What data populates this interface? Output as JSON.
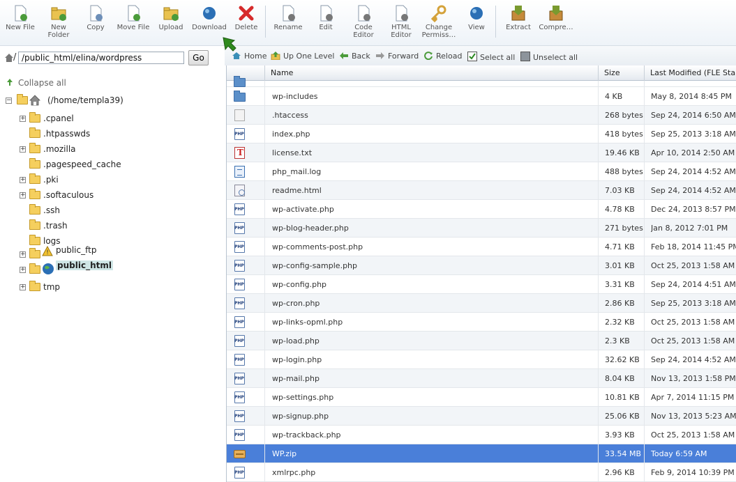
{
  "toolbar": {
    "buttons": [
      {
        "label": "New File",
        "icon": "new-file-icon"
      },
      {
        "label": "New\nFolder",
        "icon": "new-folder-icon"
      },
      {
        "label": "Copy",
        "icon": "copy-icon"
      },
      {
        "label": "Move File",
        "icon": "move-file-icon"
      },
      {
        "label": "Upload",
        "icon": "upload-icon"
      },
      {
        "label": "Download",
        "icon": "download-icon"
      },
      {
        "label": "Delete",
        "icon": "delete-icon"
      },
      {
        "label": "Rename",
        "icon": "rename-icon"
      },
      {
        "label": "Edit",
        "icon": "edit-icon"
      },
      {
        "label": "Code\nEditor",
        "icon": "code-editor-icon"
      },
      {
        "label": "HTML\nEditor",
        "icon": "html-editor-icon"
      },
      {
        "label": "Change\nPermiss…",
        "icon": "change-permissions-icon"
      },
      {
        "label": "View",
        "icon": "view-icon"
      },
      {
        "label": "Extract",
        "icon": "extract-icon"
      },
      {
        "label": "Compre…",
        "icon": "compress-icon"
      }
    ]
  },
  "pathbar": {
    "value": "/public_html/elina/wordpress",
    "go_label": "Go"
  },
  "tree": {
    "collapse_label": "Collapse all",
    "root": "(/home/templa39)",
    "items": [
      {
        "name": ".cpanel",
        "expandable": true
      },
      {
        "name": ".htpasswds",
        "expandable": false
      },
      {
        "name": ".mozilla",
        "expandable": true
      },
      {
        "name": ".pagespeed_cache",
        "expandable": false
      },
      {
        "name": ".pki",
        "expandable": true
      },
      {
        "name": ".softaculous",
        "expandable": true
      },
      {
        "name": ".ssh",
        "expandable": false
      },
      {
        "name": ".trash",
        "expandable": false
      },
      {
        "name": "logs",
        "expandable": false
      },
      {
        "name": "public_ftp",
        "expandable": true
      },
      {
        "name": "public_html",
        "expandable": true
      },
      {
        "name": "tmp",
        "expandable": true
      }
    ]
  },
  "nav": {
    "home": "Home",
    "up": "Up One Level",
    "back": "Back",
    "forward": "Forward",
    "reload": "Reload",
    "select_all": "Select all",
    "unselect_all": "Unselect all"
  },
  "table": {
    "headers": {
      "name": "Name",
      "size": "Size",
      "modified": "Last Modified (FLE Stand"
    },
    "rows": [
      {
        "name": "wp-includes",
        "size": "4 KB",
        "modified": "May 8, 2014 8:45 PM",
        "type": "folder"
      },
      {
        "name": ".htaccess",
        "size": "268 bytes",
        "modified": "Sep 24, 2014 6:50 AM",
        "type": "generic"
      },
      {
        "name": "index.php",
        "size": "418 bytes",
        "modified": "Sep 25, 2013 3:18 AM",
        "type": "php"
      },
      {
        "name": "license.txt",
        "size": "19.46 KB",
        "modified": "Apr 10, 2014 2:50 AM",
        "type": "text"
      },
      {
        "name": "php_mail.log",
        "size": "488 bytes",
        "modified": "Sep 24, 2014 4:52 AM",
        "type": "log"
      },
      {
        "name": "readme.html",
        "size": "7.03 KB",
        "modified": "Sep 24, 2014 4:52 AM",
        "type": "html"
      },
      {
        "name": "wp-activate.php",
        "size": "4.78 KB",
        "modified": "Dec 24, 2013 8:57 PM",
        "type": "php"
      },
      {
        "name": "wp-blog-header.php",
        "size": "271 bytes",
        "modified": "Jan 8, 2012 7:01 PM",
        "type": "php"
      },
      {
        "name": "wp-comments-post.php",
        "size": "4.71 KB",
        "modified": "Feb 18, 2014 11:45 PM",
        "type": "php"
      },
      {
        "name": "wp-config-sample.php",
        "size": "3.01 KB",
        "modified": "Oct 25, 2013 1:58 AM",
        "type": "php"
      },
      {
        "name": "wp-config.php",
        "size": "3.31 KB",
        "modified": "Sep 24, 2014 4:51 AM",
        "type": "php"
      },
      {
        "name": "wp-cron.php",
        "size": "2.86 KB",
        "modified": "Sep 25, 2013 3:18 AM",
        "type": "php"
      },
      {
        "name": "wp-links-opml.php",
        "size": "2.32 KB",
        "modified": "Oct 25, 2013 1:58 AM",
        "type": "php"
      },
      {
        "name": "wp-load.php",
        "size": "2.3 KB",
        "modified": "Oct 25, 2013 1:58 AM",
        "type": "php"
      },
      {
        "name": "wp-login.php",
        "size": "32.62 KB",
        "modified": "Sep 24, 2014 4:52 AM",
        "type": "php"
      },
      {
        "name": "wp-mail.php",
        "size": "8.04 KB",
        "modified": "Nov 13, 2013 1:58 PM",
        "type": "php"
      },
      {
        "name": "wp-settings.php",
        "size": "10.81 KB",
        "modified": "Apr 7, 2014 11:15 PM",
        "type": "php"
      },
      {
        "name": "wp-signup.php",
        "size": "25.06 KB",
        "modified": "Nov 13, 2013 5:23 AM",
        "type": "php"
      },
      {
        "name": "wp-trackback.php",
        "size": "3.93 KB",
        "modified": "Oct 25, 2013 1:58 AM",
        "type": "php"
      },
      {
        "name": "WP.zip",
        "size": "33.54 MB",
        "modified": "Today 6:59 AM",
        "type": "zip",
        "selected": true
      },
      {
        "name": "xmlrpc.php",
        "size": "2.96 KB",
        "modified": "Feb 9, 2014 10:39 PM",
        "type": "php"
      }
    ]
  },
  "colors": {
    "selected_row": "#4a7fd9",
    "arrow": "#2f8a1e"
  }
}
